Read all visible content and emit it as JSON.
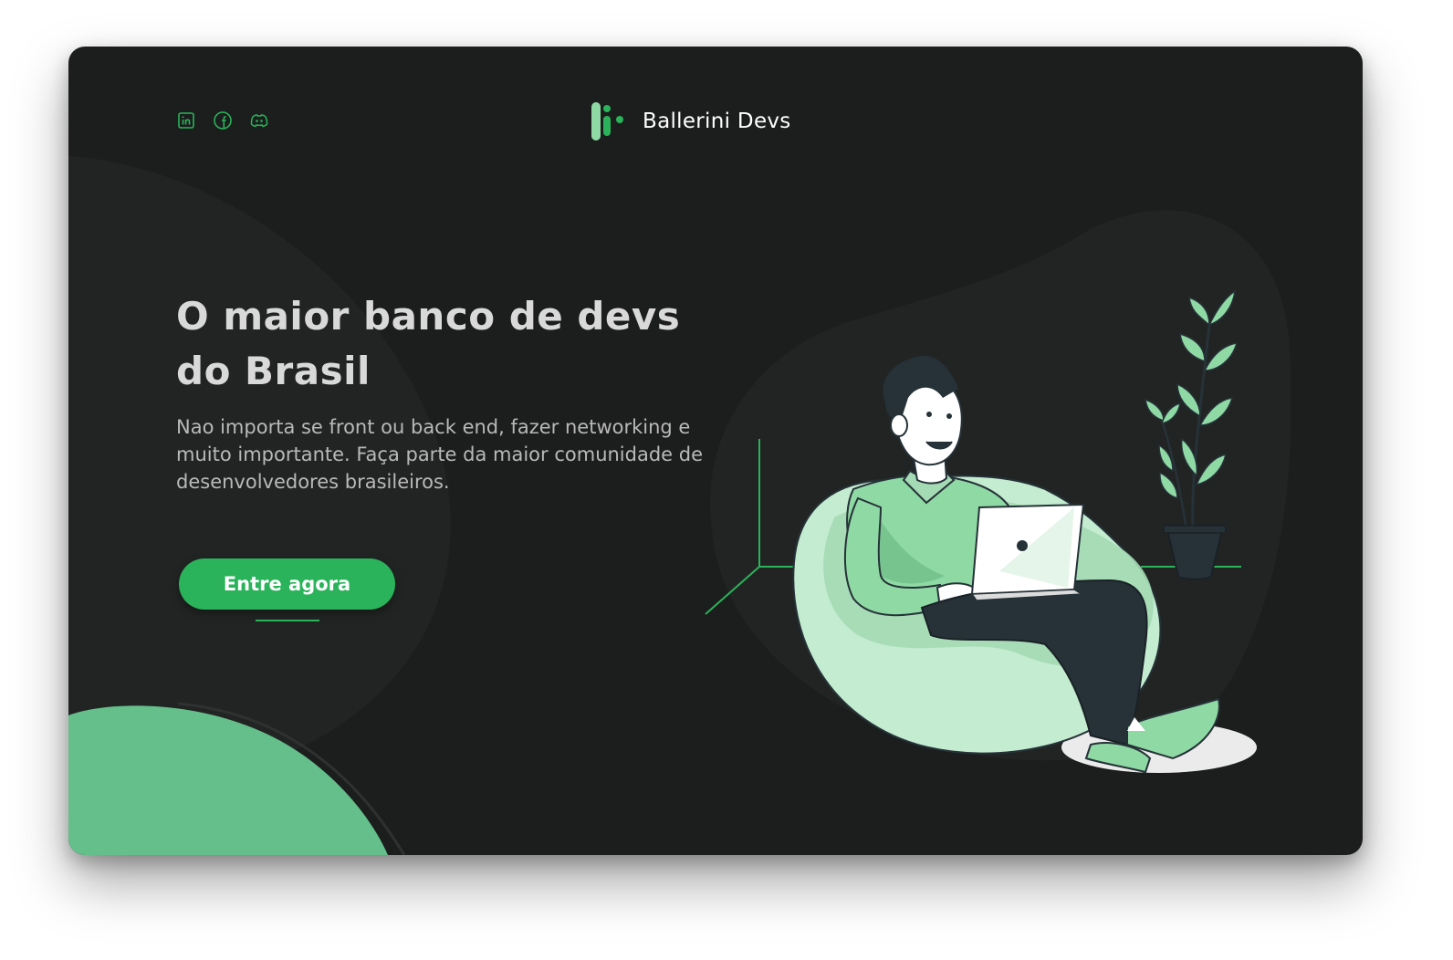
{
  "brand": {
    "name": "Ballerini Devs"
  },
  "social": {
    "icons": [
      "linkedin-icon",
      "facebook-icon",
      "discord-icon"
    ]
  },
  "hero": {
    "title": "O maior banco de devs do Brasil",
    "description": "Nao importa se front ou back end,  fazer networking e muito importante. Faça parte da maior comunidade de desenvolvedores brasileiros.",
    "cta_label": "Entre agora"
  },
  "colors": {
    "background": "#1c1d1d",
    "accent": "#2ab35a",
    "accent_light": "#8fd9a4",
    "title_text": "#d9d9d9",
    "body_text": "#b9b9b9"
  }
}
